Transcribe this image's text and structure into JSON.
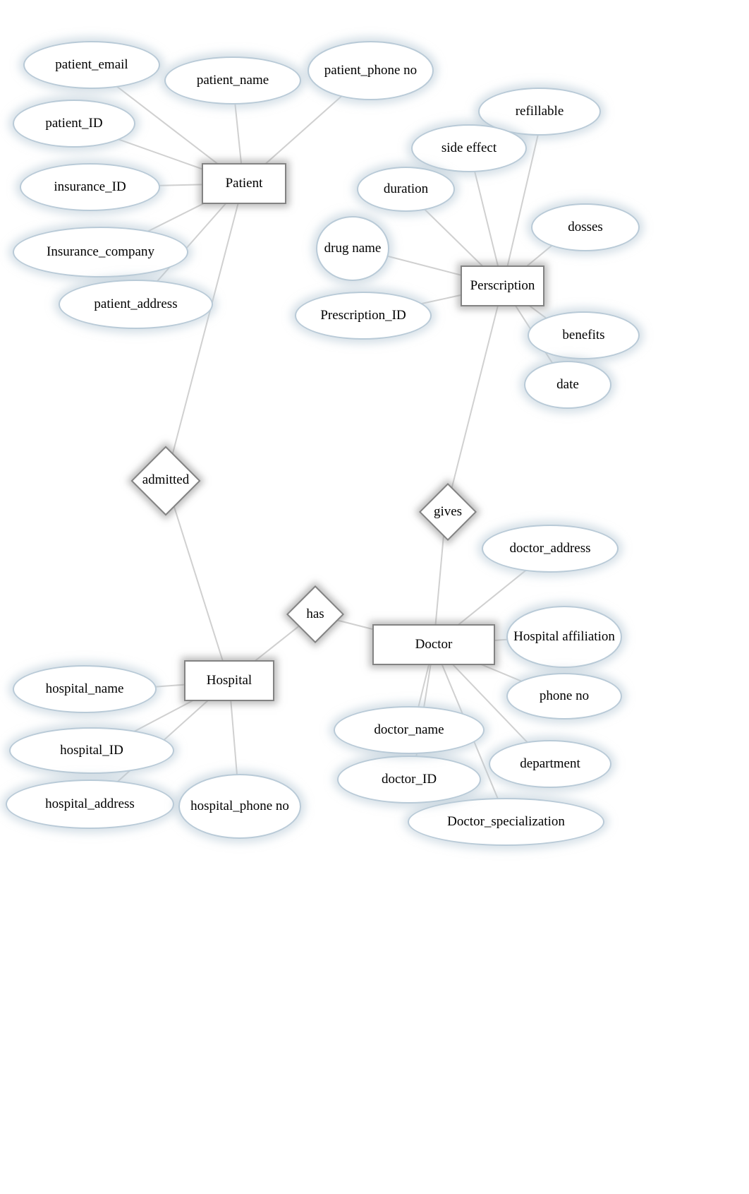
{
  "entities": {
    "patient": "Patient",
    "prescription": "Perscription",
    "hospital": "Hospital",
    "doctor": "Doctor"
  },
  "relationships": {
    "admitted": "admitted",
    "gives": "gives",
    "has": "has"
  },
  "attributes": {
    "patient_email": "patient_email",
    "patient_name": "patient_name",
    "patient_phone_no": "patient_phone no",
    "patient_id": "patient_ID",
    "insurance_id": "insurance_ID",
    "insurance_company": "Insurance_company",
    "patient_address": "patient_address",
    "refillable": "refillable",
    "side_effect": "side effect",
    "duration": "duration",
    "drug_name": "drug name",
    "prescription_id": "Prescription_ID",
    "dosses": "dosses",
    "benefits": "benefits",
    "date": "date",
    "doctor_address": "doctor_address",
    "hospital_affiliation": "Hospital affiliation",
    "phone_no": "phone no",
    "department": "department",
    "doctor_specialization": "Doctor_specialization",
    "doctor_id": "doctor_ID",
    "doctor_name": "doctor_name",
    "hospital_name": "hospital_name",
    "hospital_id": "hospital_ID",
    "hospital_address": "hospital_address",
    "hospital_phone_no": "hospital_phone no"
  }
}
